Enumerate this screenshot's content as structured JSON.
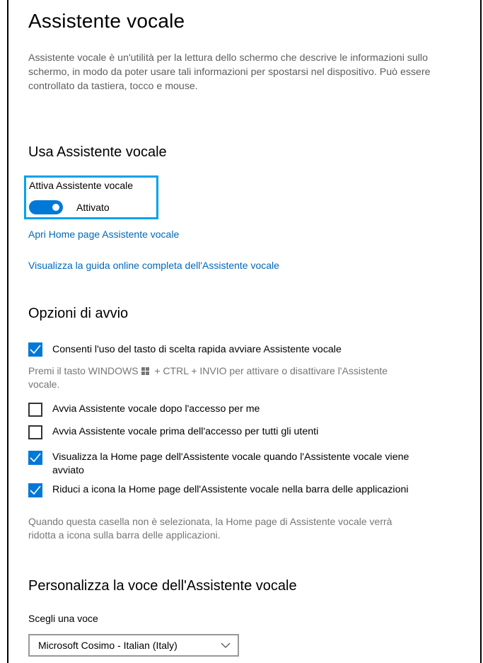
{
  "page": {
    "title": "Assistente vocale",
    "description": "Assistente vocale è un'utilità per la lettura dello schermo che descrive le informazioni sullo schermo, in modo da poter usare tali informazioni per spostarsi nel dispositivo. Può essere controllato da tastiera, tocco e mouse."
  },
  "use_section": {
    "heading": "Usa Assistente vocale",
    "toggle_label": "Attiva Assistente vocale",
    "toggle_state": "Attivato",
    "toggle_on": true,
    "link_home": "Apri Home page Assistente vocale",
    "link_guide": "Visualizza la guida online completa dell'Assistente vocale"
  },
  "startup_section": {
    "heading": "Opzioni di avvio",
    "options": [
      {
        "label": "Consenti l'uso del tasto di scelta rapida avviare Assistente vocale",
        "checked": true
      },
      {
        "label": "Avvia Assistente vocale dopo l'accesso per me",
        "checked": false
      },
      {
        "label": "Avvia Assistente vocale prima dell'accesso per tutti gli utenti",
        "checked": false
      },
      {
        "label": "Visualizza la Home page dell'Assistente vocale quando l'Assistente vocale viene avviato",
        "checked": true
      },
      {
        "label": "Riduci a icona la Home page dell'Assistente vocale nella barra delle applicazioni",
        "checked": true
      }
    ],
    "shortcut_help_before": "Premi il tasto WINDOWS",
    "shortcut_help_after": "+ CTRL + INVIO per attivare o disattivare l'Assistente vocale.",
    "minimize_help": "Quando questa casella non è selezionata, la Home page di Assistente vocale verrà ridotta a icona sulla barra delle applicazioni."
  },
  "voice_section": {
    "heading": "Personalizza la voce dell'Assistente vocale",
    "select_label": "Scegli una voce",
    "selected_voice": "Microsoft Cosimo - Italian (Italy)"
  },
  "icons": {
    "windows_key": "windows-logo-icon",
    "check": "checkmark-icon",
    "dropdown": "chevron-down-icon"
  },
  "colors": {
    "accent": "#0078d7",
    "link": "#0067b8",
    "focus_highlight": "#00a2ed",
    "secondary_text": "#767676"
  }
}
